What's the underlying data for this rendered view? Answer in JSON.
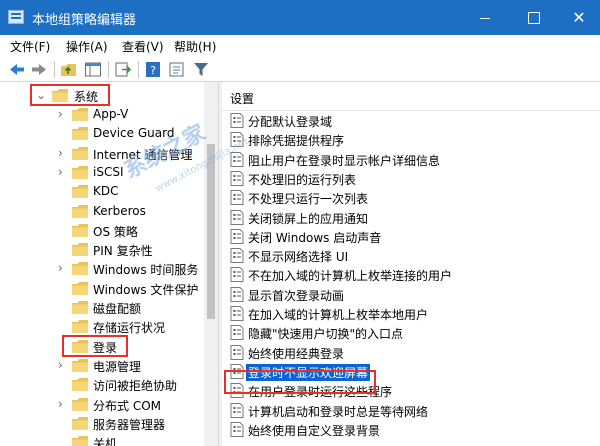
{
  "window": {
    "title": "本地组策略编辑器"
  },
  "menu": [
    "文件(F)",
    "操作(A)",
    "查看(V)",
    "帮助(H)"
  ],
  "toolbar": [
    "back-icon",
    "forward-icon",
    "up-folder-icon",
    "show-hide-tree-icon",
    "export-list-icon",
    "help-icon",
    "properties-icon",
    "filter-icon"
  ],
  "tree": {
    "parent": "系统",
    "items": [
      {
        "label": "App-V",
        "expandable": true
      },
      {
        "label": "Device Guard",
        "expandable": false
      },
      {
        "label": "Internet 通信管理",
        "expandable": true
      },
      {
        "label": "iSCSI",
        "expandable": true
      },
      {
        "label": "KDC",
        "expandable": false
      },
      {
        "label": "Kerberos",
        "expandable": false
      },
      {
        "label": "OS 策略",
        "expandable": false
      },
      {
        "label": "PIN 复杂性",
        "expandable": false
      },
      {
        "label": "Windows 时间服务",
        "expandable": true
      },
      {
        "label": "Windows 文件保护",
        "expandable": false
      },
      {
        "label": "磁盘配额",
        "expandable": false
      },
      {
        "label": "存储运行状况",
        "expandable": false
      },
      {
        "label": "登录",
        "expandable": false,
        "selected": true
      },
      {
        "label": "电源管理",
        "expandable": true
      },
      {
        "label": "访问被拒绝协助",
        "expandable": false
      },
      {
        "label": "分布式 COM",
        "expandable": true
      },
      {
        "label": "服务器管理器",
        "expandable": false
      },
      {
        "label": "关机",
        "expandable": false
      }
    ]
  },
  "list": {
    "header": "设置",
    "items": [
      "分配默认登录域",
      "排除凭据提供程序",
      "阻止用户在登录时显示帐户详细信息",
      "不处理旧的运行列表",
      "不处理只运行一次列表",
      "关闭锁屏上的应用通知",
      "关闭 Windows 启动声音",
      "不显示网络选择 UI",
      "不在加入域的计算机上枚举连接的用户",
      "显示首次登录动画",
      "在加入域的计算机上枚举本地用户",
      "隐藏\"快速用户切换\"的入口点",
      "始终使用经典登录",
      "登录时不显示欢迎屏幕",
      "在用户登录时运行这些程序",
      "计算机启动和登录时总是等待网络",
      "始终使用自定义登录背景"
    ],
    "selected_index": 13
  },
  "watermark": {
    "main": "系统之家",
    "sub": "www.xitongzhijia.net"
  },
  "colors": {
    "titlebar": "#1c6fc3",
    "selection": "#0a64d6",
    "highlight_box": "#e8302b"
  }
}
